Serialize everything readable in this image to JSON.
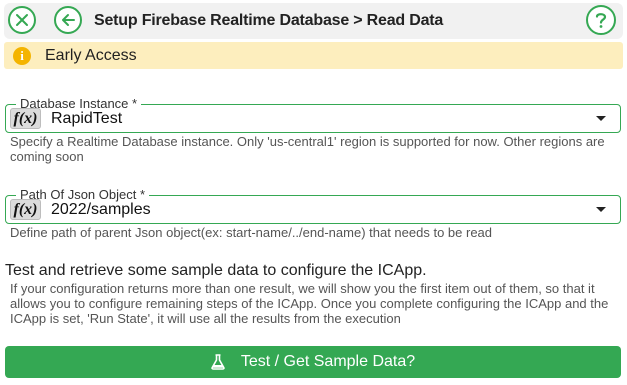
{
  "header": {
    "title": "Setup Firebase Realtime Database > Read Data",
    "close_icon": "close-x-icon",
    "back_icon": "arrow-left-icon",
    "help_icon": "question-icon",
    "accent": "#35a853"
  },
  "banner": {
    "icon": "info-icon",
    "text": "Early Access",
    "background": "#fdeebe"
  },
  "database_instance": {
    "label": "Database Instance *",
    "fx_label": "f(x)",
    "value": "RapidTest",
    "helper": "Specify a Realtime Database instance. Only 'us-central1' region is supported for now. Other regions are coming soon"
  },
  "path": {
    "label": "Path Of Json Object *",
    "fx_label": "f(x)",
    "value": "2022/samples",
    "helper": "Define path of parent Json object(ex: start-name/../end-name) that needs to be read"
  },
  "test_section": {
    "title": "Test and retrieve some sample data to configure the ICApp.",
    "description": "If your configuration returns more than one result, we will show you the first item out of them, so that it allows you to configure remaining steps of the ICApp. Once you complete configuring the ICApp and the ICApp is set, 'Run State', it will use all the results from the execution",
    "button_label": "Test / Get Sample Data?",
    "button_icon": "flask-icon",
    "button_color": "#34a853"
  }
}
